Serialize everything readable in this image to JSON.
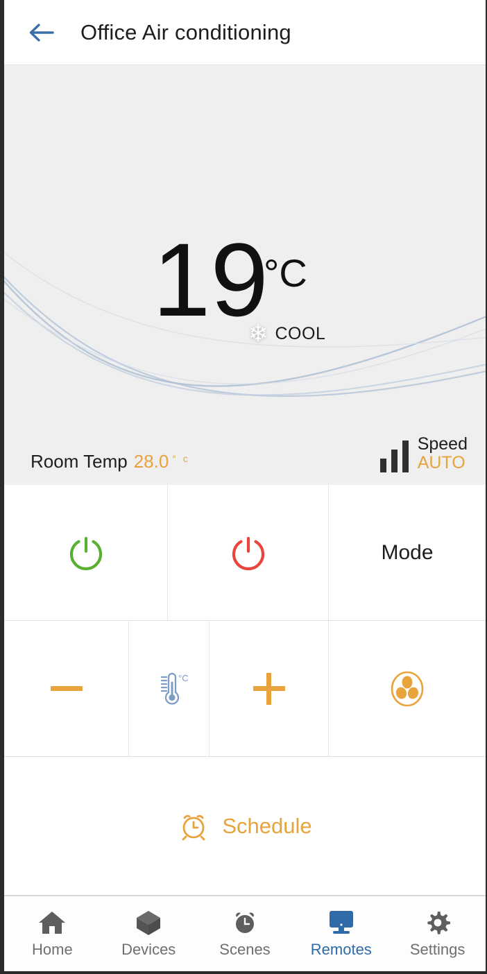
{
  "header": {
    "back_icon": "arrow-left-icon",
    "title": "Office Air conditioning",
    "accent": "#3a6fa8"
  },
  "display": {
    "temperature": "19",
    "temperature_unit": "°C",
    "mode_icon": "snowflake-icon",
    "mode_label": "COOL",
    "room_temp_label": "Room Temp",
    "room_temp_value": "28.0",
    "room_temp_unit": "° c",
    "fan_speed_label": "Speed",
    "fan_speed_value": "AUTO",
    "speed_icon": "signal-bars-icon",
    "background_color": "#efefef",
    "accent_color": "#e8a33d"
  },
  "controls": {
    "row1": [
      {
        "name": "power-on",
        "icon": "power-icon",
        "label": "",
        "color": "#58b030"
      },
      {
        "name": "power-off",
        "icon": "power-icon",
        "label": "",
        "color": "#e8453c"
      },
      {
        "name": "mode",
        "icon": "",
        "label": "Mode",
        "color": "#1c1c1c"
      }
    ],
    "row2": [
      {
        "name": "temp-decrease",
        "icon": "minus-icon",
        "label": "",
        "color": "#e8a33d"
      },
      {
        "name": "temperature",
        "icon": "thermometer-icon",
        "label": "°C",
        "color": "#7e9cc4"
      },
      {
        "name": "temp-increase",
        "icon": "plus-icon",
        "label": "",
        "color": "#e8a33d"
      },
      {
        "name": "fan-speed",
        "icon": "fan-icon",
        "label": "",
        "color": "#e8a33d"
      }
    ]
  },
  "schedule": {
    "icon": "alarm-clock-icon",
    "label": "Schedule",
    "color": "#e8a33d"
  },
  "nav": {
    "active_color": "#2e6ba8",
    "inactive_color": "#5e5e5e",
    "items": [
      {
        "label": "Home",
        "icon": "home-icon",
        "active": false
      },
      {
        "label": "Devices",
        "icon": "cube-icon",
        "active": false
      },
      {
        "label": "Scenes",
        "icon": "alarm-icon",
        "active": false
      },
      {
        "label": "Remotes",
        "icon": "monitor-icon",
        "active": true
      },
      {
        "label": "Settings",
        "icon": "gear-icon",
        "active": false
      }
    ]
  }
}
